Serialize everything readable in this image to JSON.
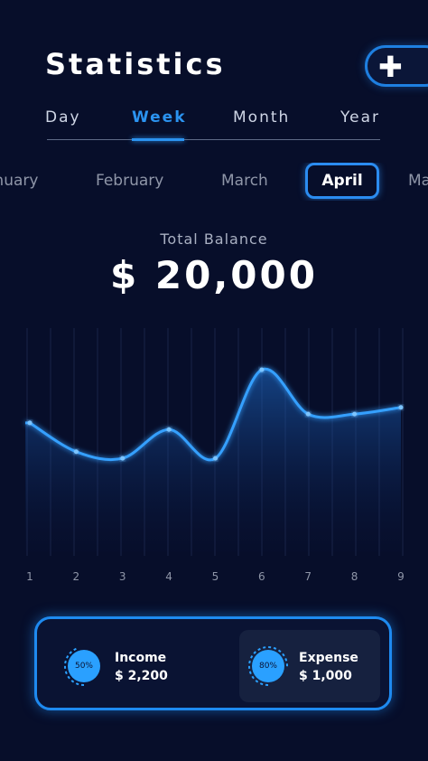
{
  "header": {
    "title": "Statistics",
    "add_icon": "plus-icon"
  },
  "period_tabs": [
    {
      "label": "Day",
      "active": false
    },
    {
      "label": "Week",
      "active": true
    },
    {
      "label": "Month",
      "active": false
    },
    {
      "label": "Year",
      "active": false
    }
  ],
  "months": [
    {
      "label": "January",
      "active": false
    },
    {
      "label": "February",
      "active": false
    },
    {
      "label": "March",
      "active": false
    },
    {
      "label": "April",
      "active": true
    },
    {
      "label": "May",
      "active": false
    }
  ],
  "balance": {
    "label": "Total Balance",
    "value": "$ 20,000"
  },
  "chart_data": {
    "type": "area",
    "x": [
      1,
      2,
      3,
      4,
      5,
      6,
      7,
      8,
      9
    ],
    "x_tick_labels": [
      "1",
      "2",
      "3",
      "4",
      "5",
      "6",
      "7",
      "8",
      "9"
    ],
    "series": [
      {
        "values": [
          0.58,
          0.45,
          0.42,
          0.55,
          0.42,
          0.82,
          0.62,
          0.62,
          0.65
        ]
      }
    ],
    "ylim": [
      0,
      1
    ],
    "grid": "vertical",
    "accent_color": "#2b93f0"
  },
  "summary": {
    "income": {
      "label": "Income",
      "amount": "$ 2,200",
      "percent": "50%",
      "percent_value": 50,
      "icon": "progress-ring-icon"
    },
    "expense": {
      "label": "Expense",
      "amount": "$ 1,000",
      "percent": "80%",
      "percent_value": 80,
      "icon": "progress-ring-icon"
    }
  },
  "colors": {
    "background": "#070e2a",
    "accent": "#2b93f0",
    "muted_text": "#8f96a8"
  }
}
